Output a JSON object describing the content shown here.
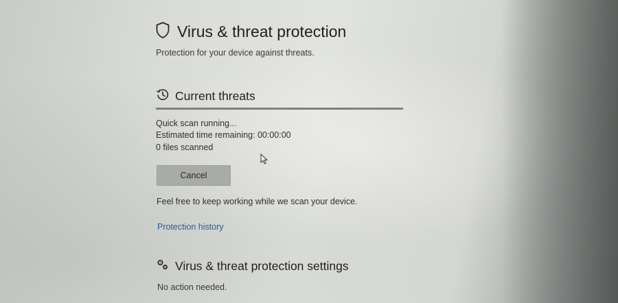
{
  "page": {
    "title": "Virus & threat protection",
    "subtitle": "Protection for your device against threats.",
    "title_icon": "shield-icon"
  },
  "current_threats": {
    "title": "Current threats",
    "icon": "history-clock-icon",
    "progress": 1.0,
    "status": "Quick scan running...",
    "time_remaining": "Estimated time remaining: 00:00:00",
    "files_scanned": "0 files scanned",
    "cancel_label": "Cancel",
    "info": "Feel free to keep working while we scan your device.",
    "history_link": "Protection history"
  },
  "settings": {
    "title": "Virus & threat protection settings",
    "icon": "gears-icon",
    "status": "No action needed."
  },
  "colors": {
    "link": "#2e5b8a",
    "button": "#a9aba8",
    "progress_fill": "#7d807d"
  }
}
